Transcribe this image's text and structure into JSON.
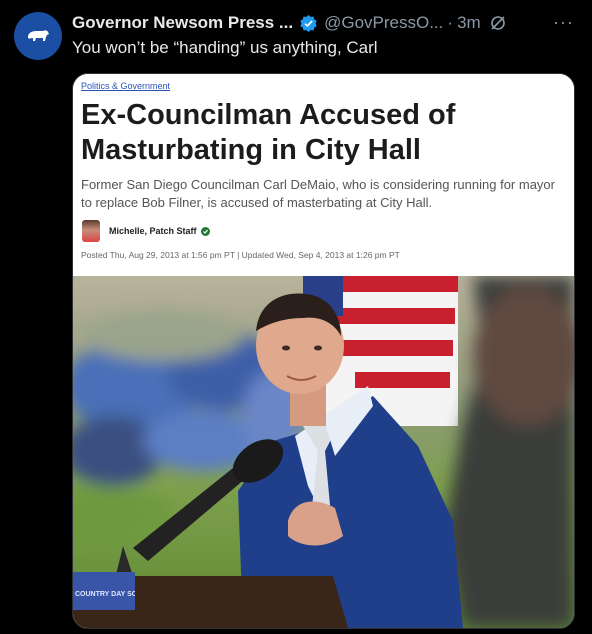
{
  "tweet": {
    "display_name": "Governor Newsom Press ...",
    "handle": "@GovPressO...",
    "separator": "·",
    "time": "3m",
    "more_label": "···",
    "text": "You won’t be “handing” us anything, Carl",
    "avatar_icon": "bear-icon",
    "verified_icon": "verified-badge-icon",
    "grok_icon": "grok-icon"
  },
  "article": {
    "category": "Politics & Government",
    "headline": "Ex-Councilman Accused of Masturbating in City Hall",
    "dek": "Former San Diego Councilman Carl DeMaio, who is considering running for mayor to replace Bob Filner, is accused of masterbating at City Hall.",
    "author": "Michelle, Patch Staff",
    "dates": "Posted Thu, Aug 29, 2013 at 1:56 pm PT  |  Updated Wed, Sep 4, 2013 at 1:26 pm PT"
  },
  "photo": {
    "podium_sign": "COUNTRY DAY SCHOOL"
  },
  "colors": {
    "background": "#000000",
    "text_primary": "#e7e9ea",
    "text_secondary": "#8b98a5",
    "verified": "#1d9bf0",
    "avatar_bg": "#1a4fa3"
  }
}
